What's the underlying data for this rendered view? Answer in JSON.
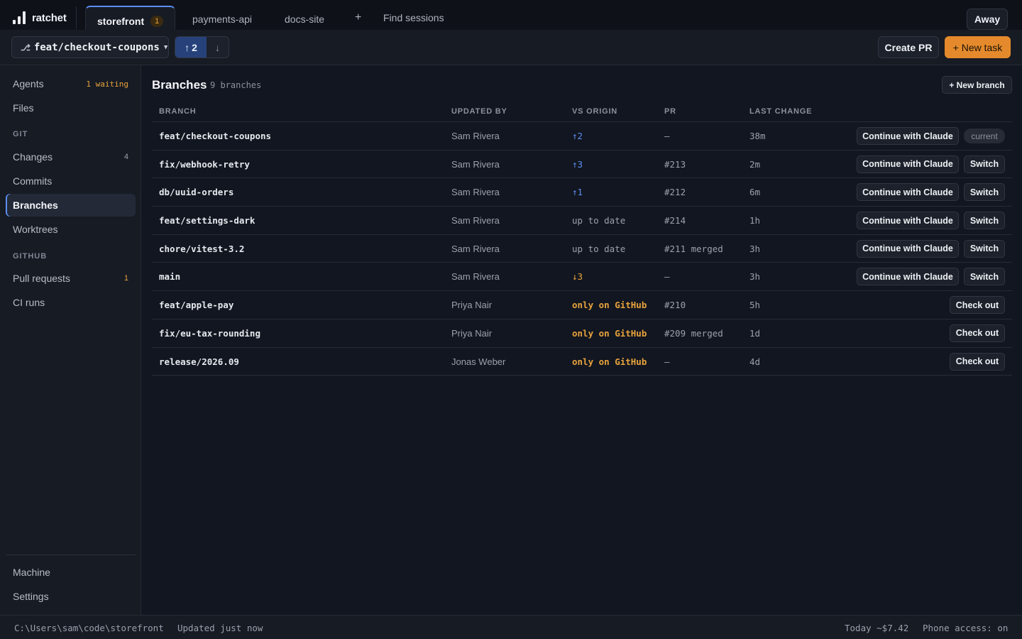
{
  "app": {
    "name": "ratchet"
  },
  "tabs": [
    {
      "label": "storefront",
      "badge": "1",
      "active": true
    },
    {
      "label": "payments-api"
    },
    {
      "label": "docs-site"
    }
  ],
  "topbar": {
    "new_tab": "+",
    "find_sessions": "Find sessions",
    "away": "Away"
  },
  "toolbar": {
    "branch": "feat/checkout-coupons",
    "push_count": "2",
    "create_pr": "Create PR",
    "new_task": "+ New task"
  },
  "sidebar": {
    "agents": {
      "label": "Agents",
      "status": "1 waiting"
    },
    "files": "Files",
    "git_heading": "GIT",
    "changes": {
      "label": "Changes",
      "count": "4"
    },
    "commits": "Commits",
    "branches": "Branches",
    "worktrees": "Worktrees",
    "github_heading": "GITHUB",
    "pull_requests": {
      "label": "Pull requests",
      "count": "1"
    },
    "ci_runs": "CI runs",
    "machine": "Machine",
    "settings": "Settings"
  },
  "main": {
    "title": "Branches",
    "subtitle": "9 branches",
    "new_branch": "+ New branch",
    "columns": [
      "BRANCH",
      "UPDATED BY",
      "VS ORIGIN",
      "PR",
      "LAST CHANGE"
    ],
    "continue_label": "Continue with Claude",
    "switch_label": "Switch",
    "checkout_label": "Check out",
    "current_label": "current",
    "rows": [
      {
        "branch": "feat/checkout-coupons",
        "updated_by": "Sam Rivera",
        "origin": "↑2",
        "pr": "—",
        "last_change": "38m",
        "action": "current"
      },
      {
        "branch": "fix/webhook-retry",
        "updated_by": "Sam Rivera",
        "origin": "↑3",
        "pr": "#213",
        "last_change": "2m",
        "action": "switch"
      },
      {
        "branch": "db/uuid-orders",
        "updated_by": "Sam Rivera",
        "origin": "↑1",
        "pr": "#212",
        "last_change": "6m",
        "action": "switch"
      },
      {
        "branch": "feat/settings-dark",
        "updated_by": "Sam Rivera",
        "origin": "up to date",
        "pr": "#214",
        "last_change": "1h",
        "action": "switch"
      },
      {
        "branch": "chore/vitest-3.2",
        "updated_by": "Sam Rivera",
        "origin": "up to date",
        "pr": "#211 merged",
        "last_change": "3h",
        "action": "switch"
      },
      {
        "branch": "main",
        "updated_by": "Sam Rivera",
        "origin": "↓3",
        "pr": "—",
        "last_change": "3h",
        "action": "switch"
      },
      {
        "branch": "feat/apple-pay",
        "updated_by": "Priya Nair",
        "origin": "only on GitHub",
        "pr": "#210",
        "last_change": "5h",
        "action": "checkout"
      },
      {
        "branch": "fix/eu-tax-rounding",
        "updated_by": "Priya Nair",
        "origin": "only on GitHub",
        "pr": "#209 merged",
        "last_change": "1d",
        "action": "checkout"
      },
      {
        "branch": "release/2026.09",
        "updated_by": "Jonas Weber",
        "origin": "only on GitHub",
        "pr": "—",
        "last_change": "4d",
        "action": "checkout"
      }
    ]
  },
  "statusbar": {
    "path": "C:\\Users\\sam\\code\\storefront",
    "updated": "Updated just now",
    "cost": "Today ~$7.42",
    "phone": "Phone access: on"
  },
  "colors": {
    "accent": "#5b8ef0",
    "warning": "#e8a33c",
    "primary_action": "#e58a2c"
  }
}
